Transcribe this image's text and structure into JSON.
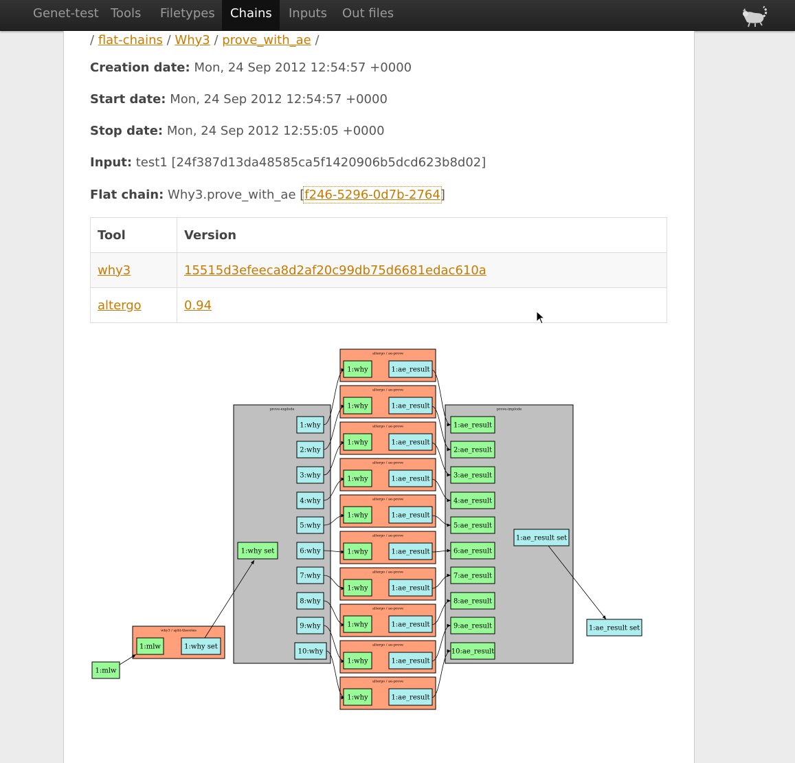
{
  "nav": {
    "items": [
      {
        "label": "Genet-test"
      },
      {
        "label": "Tools"
      },
      {
        "label": "Filetypes"
      },
      {
        "label": "Chains",
        "active": true
      },
      {
        "label": "Inputs"
      },
      {
        "label": "Out files"
      }
    ]
  },
  "breadcrumb": {
    "sep": "/",
    "items": [
      "flat-chains",
      "Why3",
      "prove_with_ae"
    ]
  },
  "details": {
    "creation_label": "Creation date:",
    "creation_value": "Mon, 24 Sep 2012 12:54:57 +0000",
    "start_label": "Start date:",
    "start_value": "Mon, 24 Sep 2012 12:54:57 +0000",
    "stop_label": "Stop date:",
    "stop_value": "Mon, 24 Sep 2012 12:55:05 +0000",
    "input_label": "Input:",
    "input_value": "test1 [24f387d13da48585ca5f1420906b5dcd623b8d02]",
    "flat_label": "Flat chain:",
    "flat_value": "Why3.prove_with_ae [",
    "flat_id": "f246-5296-0d7b-2764",
    "flat_end": "]"
  },
  "table": {
    "headers": [
      "Tool",
      "Version"
    ],
    "rows": [
      {
        "tool": "why3",
        "version": "15515d3efeeca8d2af20c99db75d6681edac610a"
      },
      {
        "tool": "altergo",
        "version": "0.94"
      }
    ]
  },
  "graph": {
    "prove_cluster_label": "prove-explode",
    "implode_cluster_label": "prove-implode",
    "split_label": "why3 / split-theories",
    "ae_prove_label": "altergo / ae-prove",
    "mlw": "1:mlw",
    "split_mlw": "1:mlw",
    "split_whyset": "1:why set",
    "whyset": "1:why set",
    "why_nodes": [
      "1:why",
      "2:why",
      "3:why",
      "4:why",
      "5:why",
      "6:why",
      "7:why",
      "8:why",
      "9:why",
      "10:why"
    ],
    "ae_in": "1:why",
    "ae_out": "1:ae_result",
    "result_nodes": [
      "1:ae_result",
      "2:ae_result",
      "3:ae_result",
      "4:ae_result",
      "5:ae_result",
      "6:ae_result",
      "7:ae_result",
      "8:ae_result",
      "9:ae_result",
      "10:ae_result"
    ],
    "result_set_inner": "1:ae_result set",
    "result_set": "1:ae_result set"
  },
  "colors": {
    "green": "#98fb98",
    "cyan": "#afeeee",
    "salmon": "#ffa07a",
    "gray": "#c0c0c0",
    "link": "#c77b00"
  }
}
